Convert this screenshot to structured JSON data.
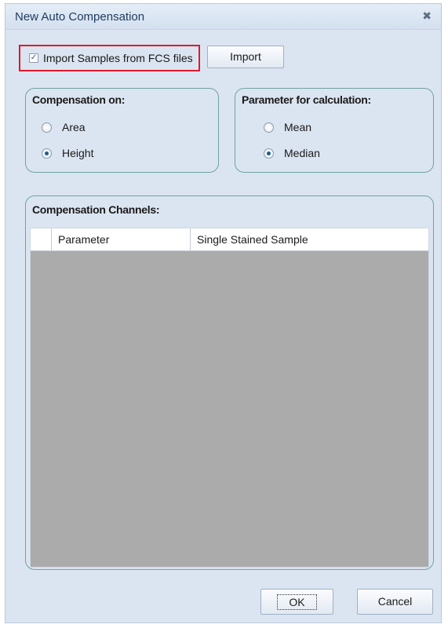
{
  "window": {
    "title": "New Auto Compensation",
    "close_glyph": "✖"
  },
  "import_section": {
    "checkbox_label": "Import Samples from FCS files",
    "checked": true,
    "import_button": "Import"
  },
  "compensation_on": {
    "title": "Compensation on:",
    "options": [
      {
        "label": "Area",
        "selected": false
      },
      {
        "label": "Height",
        "selected": true
      }
    ]
  },
  "parameter_for_calculation": {
    "title": "Parameter for calculation:",
    "options": [
      {
        "label": "Mean",
        "selected": false
      },
      {
        "label": "Median",
        "selected": true
      }
    ]
  },
  "compensation_channels": {
    "title": "Compensation Channels:",
    "columns": [
      "Parameter",
      "Single Stained Sample"
    ]
  },
  "buttons": {
    "ok": "OK",
    "cancel": "Cancel"
  }
}
